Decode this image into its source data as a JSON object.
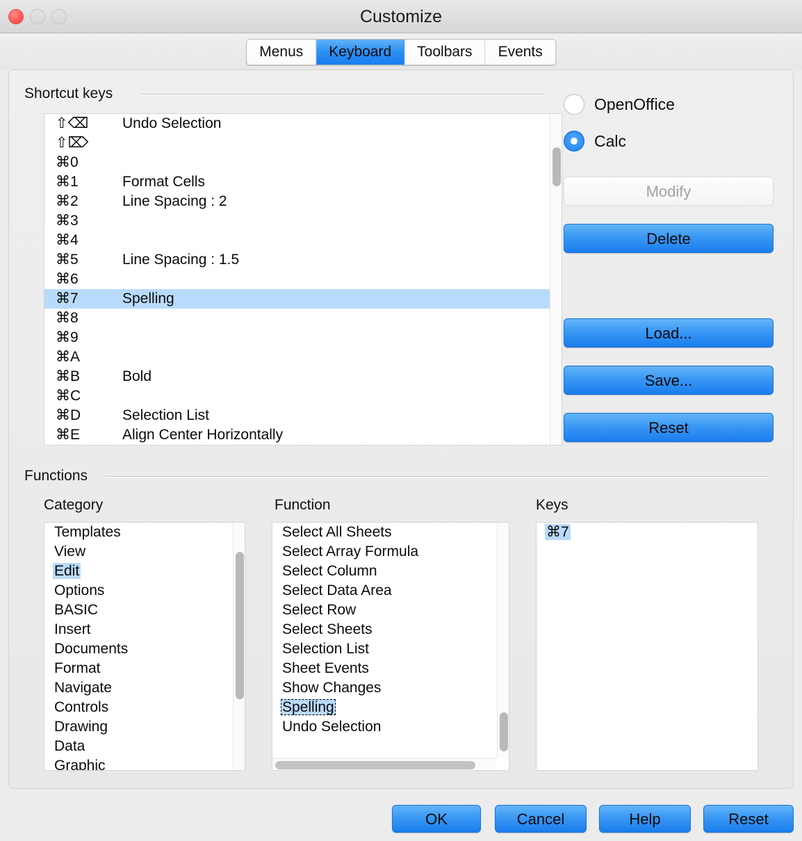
{
  "window": {
    "title": "Customize",
    "traffic_lights": [
      "close-button",
      "minimize-button",
      "zoom-button"
    ]
  },
  "tabs": [
    {
      "label": "Menus",
      "active": false
    },
    {
      "label": "Keyboard",
      "active": true
    },
    {
      "label": "Toolbars",
      "active": false
    },
    {
      "label": "Events",
      "active": false
    }
  ],
  "shortcut_keys": {
    "group_label": "Shortcut keys",
    "rows": [
      {
        "key": "⇧⌫",
        "command": "Undo Selection",
        "selected": false
      },
      {
        "key": "⇧⌦",
        "command": "",
        "selected": false
      },
      {
        "key": "⌘0",
        "command": "",
        "selected": false
      },
      {
        "key": "⌘1",
        "command": "Format Cells",
        "selected": false
      },
      {
        "key": "⌘2",
        "command": "Line Spacing : 2",
        "selected": false
      },
      {
        "key": "⌘3",
        "command": "",
        "selected": false
      },
      {
        "key": "⌘4",
        "command": "",
        "selected": false
      },
      {
        "key": "⌘5",
        "command": "Line Spacing : 1.5",
        "selected": false
      },
      {
        "key": "⌘6",
        "command": "",
        "selected": false
      },
      {
        "key": "⌘7",
        "command": "Spelling",
        "selected": true
      },
      {
        "key": "⌘8",
        "command": "",
        "selected": false
      },
      {
        "key": "⌘9",
        "command": "",
        "selected": false
      },
      {
        "key": "⌘A",
        "command": "",
        "selected": false
      },
      {
        "key": "⌘B",
        "command": "Bold",
        "selected": false
      },
      {
        "key": "⌘C",
        "command": "",
        "selected": false
      },
      {
        "key": "⌘D",
        "command": "Selection List",
        "selected": false
      },
      {
        "key": "⌘E",
        "command": "Align Center Horizontally",
        "selected": false
      }
    ]
  },
  "scope": {
    "options": [
      {
        "label": "OpenOffice",
        "selected": false
      },
      {
        "label": "Calc",
        "selected": true
      }
    ]
  },
  "side_buttons": [
    {
      "label": "Modify",
      "disabled": true
    },
    {
      "label": "Delete",
      "disabled": false
    },
    {
      "label": "Load...",
      "disabled": false
    },
    {
      "label": "Save...",
      "disabled": false
    },
    {
      "label": "Reset",
      "disabled": false
    }
  ],
  "functions": {
    "group_label": "Functions",
    "category": {
      "header": "Category",
      "items": [
        {
          "label": "Templates",
          "selected": false
        },
        {
          "label": "View",
          "selected": false
        },
        {
          "label": "Edit",
          "selected": true
        },
        {
          "label": "Options",
          "selected": false
        },
        {
          "label": "BASIC",
          "selected": false
        },
        {
          "label": "Insert",
          "selected": false
        },
        {
          "label": "Documents",
          "selected": false
        },
        {
          "label": "Format",
          "selected": false
        },
        {
          "label": "Navigate",
          "selected": false
        },
        {
          "label": "Controls",
          "selected": false
        },
        {
          "label": "Drawing",
          "selected": false
        },
        {
          "label": "Data",
          "selected": false
        },
        {
          "label": "Graphic",
          "selected": false
        }
      ]
    },
    "function": {
      "header": "Function",
      "items": [
        {
          "label": "Select All Sheets",
          "focused": false
        },
        {
          "label": "Select Array Formula",
          "focused": false
        },
        {
          "label": "Select Column",
          "focused": false
        },
        {
          "label": "Select Data Area",
          "focused": false
        },
        {
          "label": "Select Row",
          "focused": false
        },
        {
          "label": "Select Sheets",
          "focused": false
        },
        {
          "label": "Selection List",
          "focused": false
        },
        {
          "label": "Sheet Events",
          "focused": false
        },
        {
          "label": "Show Changes",
          "focused": false
        },
        {
          "label": "Spelling",
          "focused": true
        },
        {
          "label": "Undo Selection",
          "focused": false
        }
      ]
    },
    "keys": {
      "header": "Keys",
      "items": [
        {
          "label": "⌘7",
          "selected": true
        }
      ]
    }
  },
  "footer_buttons": [
    {
      "label": "OK"
    },
    {
      "label": "Cancel"
    },
    {
      "label": "Help"
    },
    {
      "label": "Reset"
    }
  ],
  "colors": {
    "accent_blue": "#1a7ded",
    "selection_blue": "#b8dbfb",
    "close_red": "#fc5753"
  }
}
